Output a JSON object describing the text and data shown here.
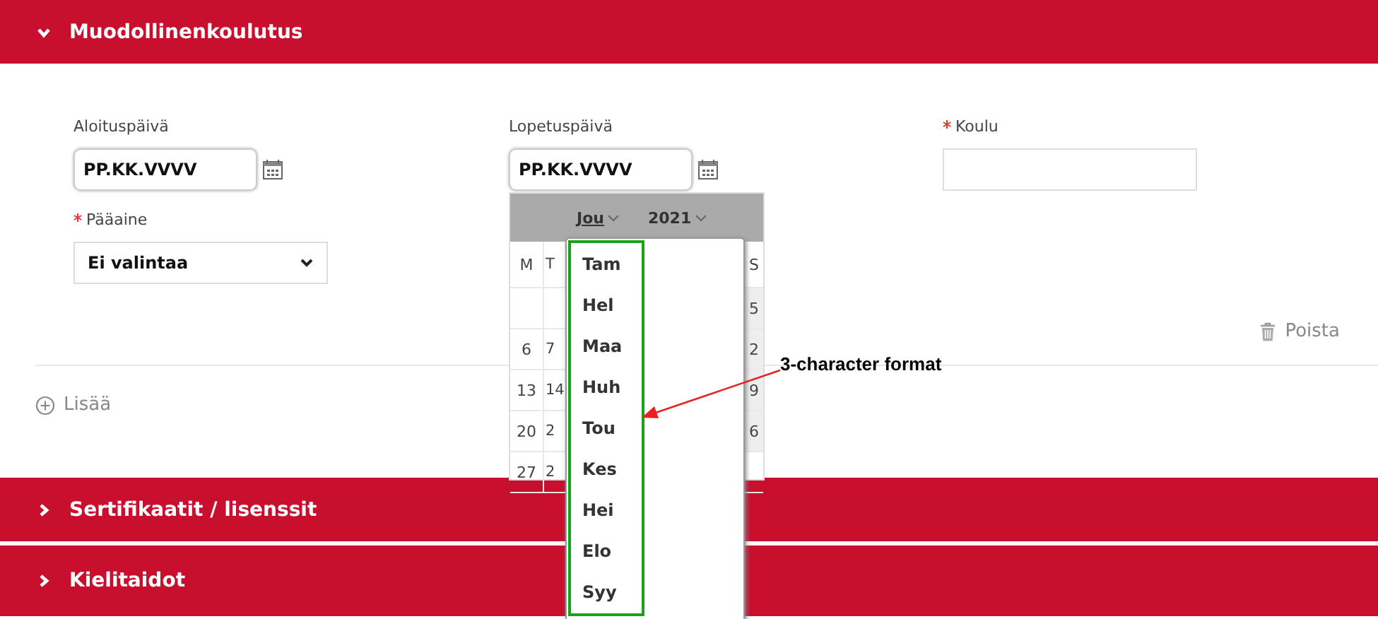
{
  "sections": [
    {
      "title": "Muodollinenkoulutus",
      "expanded": true
    },
    {
      "title": "Sertifikaatit / lisenssit",
      "expanded": false
    },
    {
      "title": "Kielitaidot",
      "expanded": false
    }
  ],
  "form": {
    "start_date": {
      "label": "Aloituspäivä",
      "required": false,
      "value": "PP.KK.VVVV"
    },
    "end_date": {
      "label": "Lopetuspäivä",
      "required": false,
      "value": "PP.KK.VVVV"
    },
    "school": {
      "label": "Koulu",
      "required": true
    },
    "major": {
      "label": "Pääaine",
      "required": true,
      "value": "Ei valintaa"
    },
    "delete_button": "Poista",
    "add_button": "Lisää"
  },
  "calendar": {
    "month": "Jou",
    "year": "2021",
    "rows": [
      {
        "kind": "weekday",
        "column_1": "M",
        "column_2": "T",
        "column_7": "S"
      },
      {
        "kind": "days",
        "column_7": "5"
      },
      {
        "kind": "days",
        "column_1": "6",
        "column_2": "7",
        "column_7": "2"
      },
      {
        "kind": "days",
        "column_1": "13",
        "column_2": "14",
        "column_7": "9"
      },
      {
        "kind": "days",
        "column_1": "20",
        "column_2": "2",
        "column_7": "6"
      },
      {
        "kind": "days",
        "column_1": "27",
        "column_2": "2"
      }
    ]
  },
  "month_dropdown": [
    "Tam",
    "Hel",
    "Maa",
    "Huh",
    "Tou",
    "Kes",
    "Hei",
    "Elo",
    "Syy"
  ],
  "annotation": {
    "label": "3-character format"
  }
}
